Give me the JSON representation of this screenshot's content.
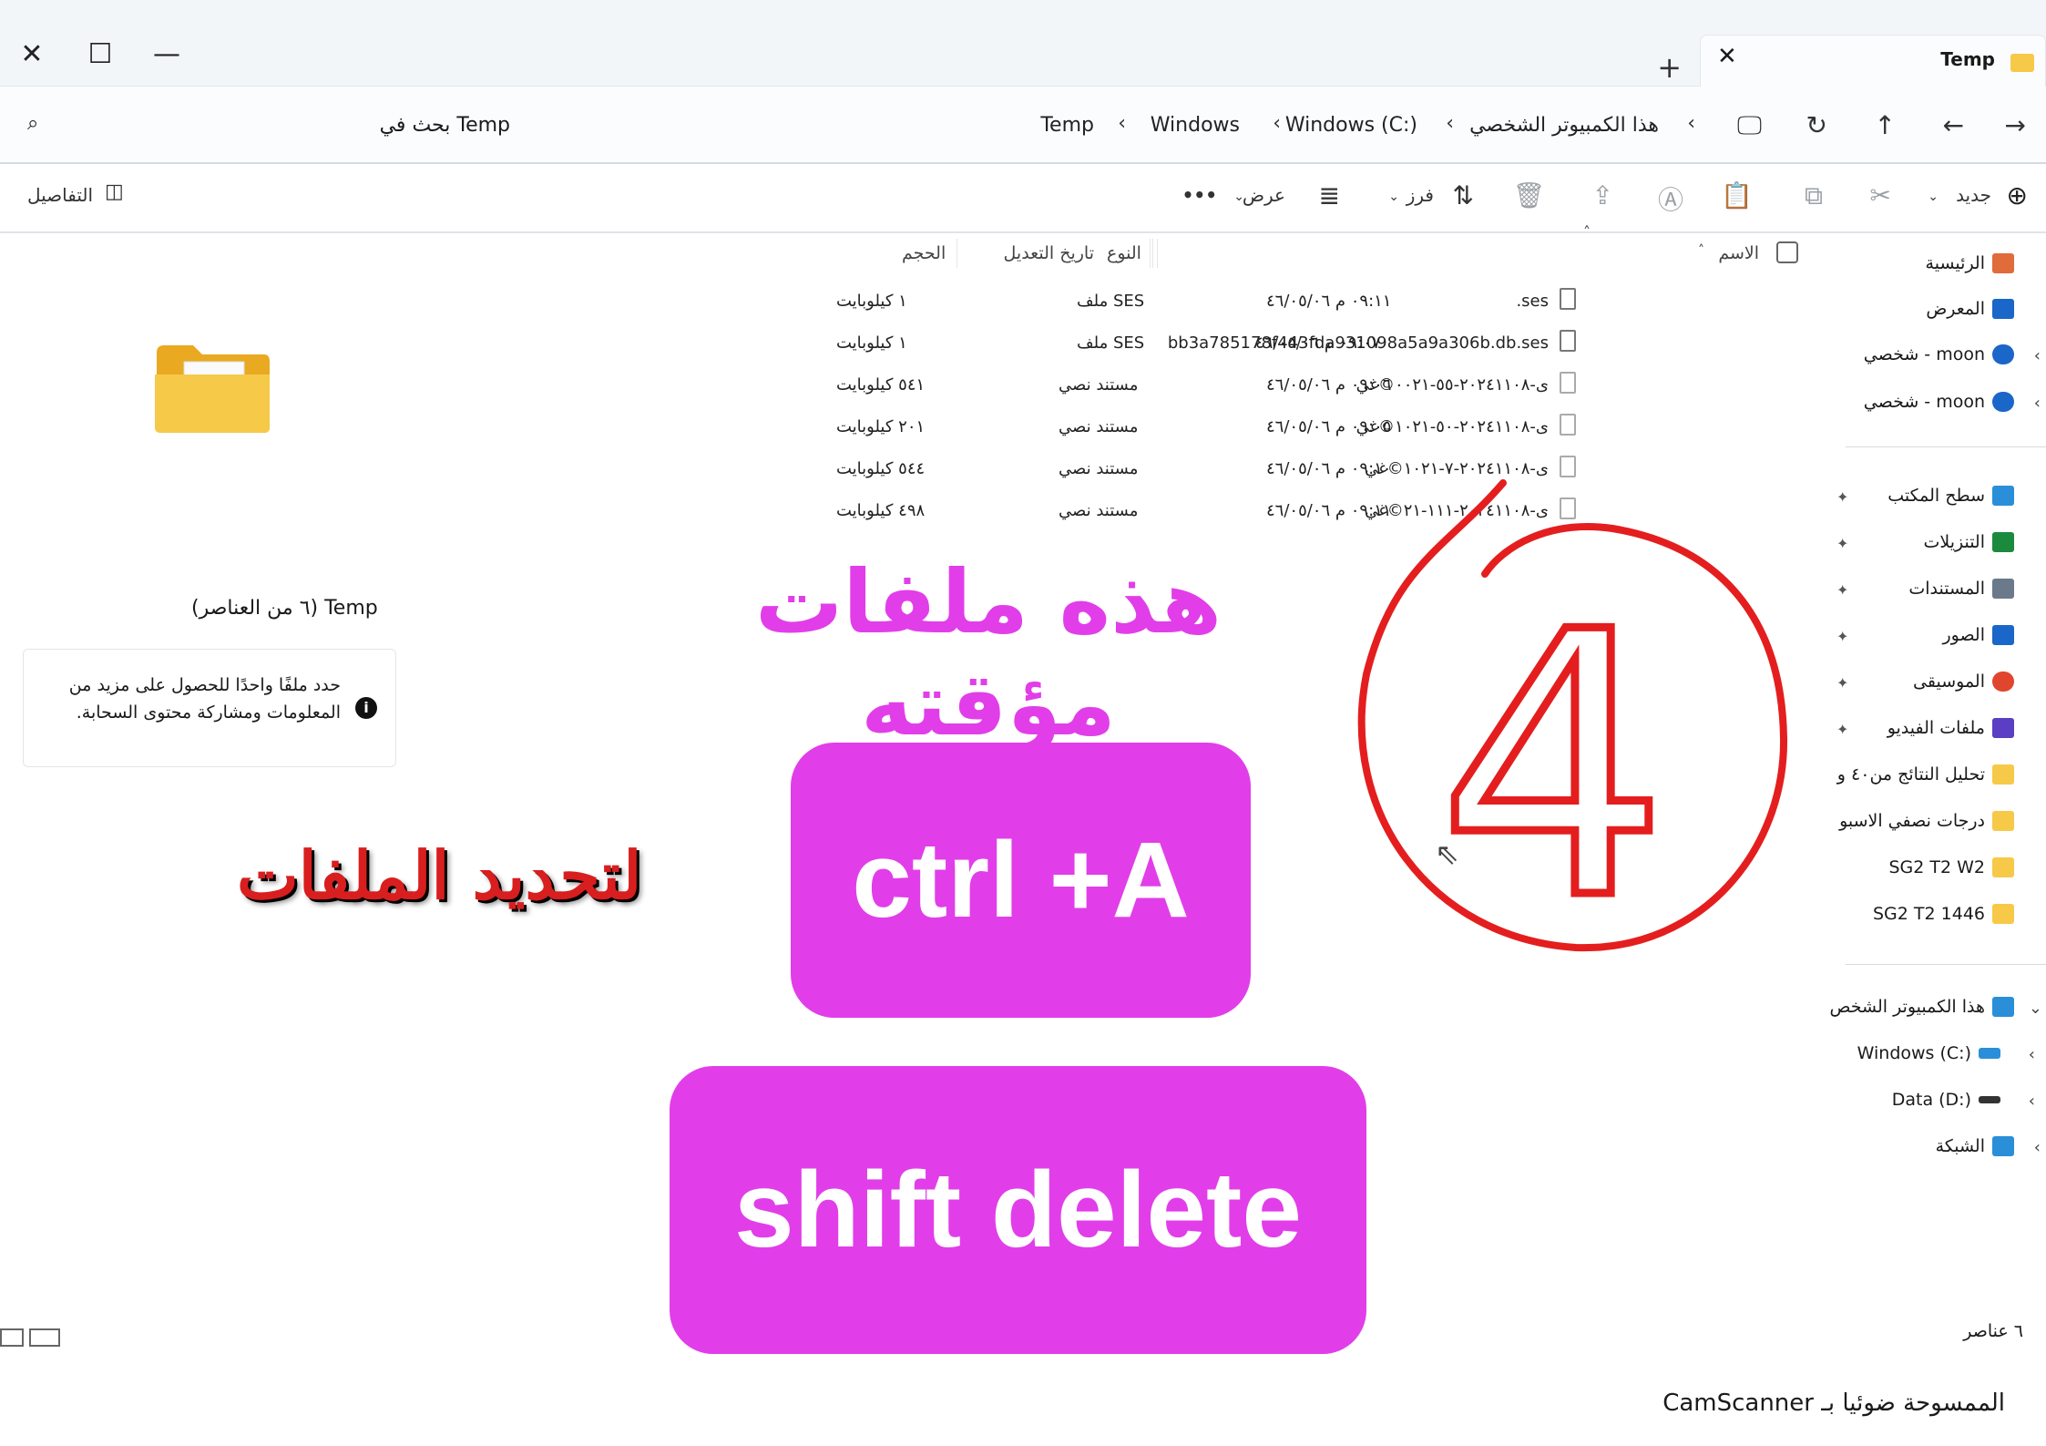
{
  "window": {
    "tab_title": "Temp",
    "close_tab": "✕",
    "new_tab": "+",
    "controls": {
      "close": "✕",
      "maximize": "☐",
      "minimize": "—"
    }
  },
  "address": {
    "breadcrumbs": [
      "هذا الكمبيوتر الشخصي",
      "Windows (C:)",
      "Windows",
      "Temp"
    ],
    "search_placeholder": "بحث في Temp"
  },
  "commandbar": {
    "new": "جديد",
    "sort": "فرز",
    "view": "عرض",
    "more": "•••",
    "details": "التفاصيل"
  },
  "sidebar": {
    "top": [
      {
        "label": "الرئيسية",
        "color": "#e06c3c"
      },
      {
        "label": "المعرض",
        "color": "#1a66c9"
      },
      {
        "label": "moon - شخصي",
        "color": "#1a66c9"
      },
      {
        "label": "moon - شخصي",
        "color": "#1a66c9"
      }
    ],
    "pinned": [
      {
        "label": "سطح المكتب",
        "color": "#2a8fd8"
      },
      {
        "label": "التنزيلات",
        "color": "#1b8a3c"
      },
      {
        "label": "المستندات",
        "color": "#6b7a8a"
      },
      {
        "label": "الصور",
        "color": "#1a66c9"
      },
      {
        "label": "الموسيقى",
        "color": "#e0462e"
      },
      {
        "label": "ملفات الفيديو",
        "color": "#5a3fc4"
      },
      {
        "label": "تحليل النتائج من٤٠ و",
        "color": "#f7c948"
      },
      {
        "label": "درجات نصفي الاسبو",
        "color": "#f7c948"
      },
      {
        "label": "SG2 T2 W2",
        "color": "#f7c948"
      },
      {
        "label": "SG2 T2 1446",
        "color": "#f7c948"
      }
    ],
    "drives": [
      {
        "label": "هذا الكمبيوتر الشخص",
        "color": "#2a8fd8"
      },
      {
        "label": "Windows (C:)",
        "color": "#2a8fd8"
      },
      {
        "label": "Data (D:)",
        "color": "#333333"
      },
      {
        "label": "الشبكة",
        "color": "#2a8fd8"
      }
    ]
  },
  "filelist": {
    "headers": {
      "name": "الاسم",
      "modified": "تاريخ التعديل",
      "type": "النوع",
      "size": "الحجم"
    },
    "rows": [
      {
        "name": ".ses",
        "modified": "٠٩:١١ م ٤٦/٠٥/٠٦",
        "type": "ملف SES",
        "size": "١ كيلوبايت"
      },
      {
        "name": "bb3a785178f443fda931098a5a9a306b.db.ses",
        "modified": "٠٩:٠٧ م ٤٦/٠٥/٠٦",
        "type": "ملف SES",
        "size": "١ كيلوبايت"
      },
      {
        "name": "ى-٢٠٢٤١١٠٨-٥٥-٠٠٢١©غي",
        "modified": "٠٩:٠٦ م ٤٦/٠٥/٠٦",
        "type": "مستند نصي",
        "size": "٥٤١ كيلوبايت"
      },
      {
        "name": "ى-٢٠٢٤١١٠٨-٥٠-١٠٢١©غي",
        "modified": "٠٩:٠٥ م ٤٦/٠٥/٠٦",
        "type": "مستند نصي",
        "size": "٢٠١ كيلوبايت"
      },
      {
        "name": "ى-٢٠٢٤١١٠٨-٧-١٠٢١©غي",
        "modified": "٠٩:١٠ م ٤٦/٠٥/٠٦",
        "type": "مستند نصي",
        "size": "٥٤٤ كيلوبايت"
      },
      {
        "name": "ى-٢٠٢٤١١٠٨-١١١-٢١©غي",
        "modified": "٠٩:١١ م ٤٦/٠٥/٠٦",
        "type": "مستند نصي",
        "size": "٤٩٨ كيلوبايت"
      }
    ]
  },
  "details": {
    "count_title": "Temp (٦ من العناصر)",
    "info": "حدد ملفًا واحدًا للحصول على مزيد من المعلومات ومشاركة محتوى السحابة.",
    "info_icon": "i"
  },
  "overlay": {
    "headline": "هذه ملفات مؤقته",
    "select_label": "لتحديد الملفات",
    "ctrl_a": "ctrl +A",
    "shift_delete": "shift delete",
    "step_number": "4"
  },
  "status": {
    "count": "٦ عناصر"
  },
  "footer": {
    "scanner": "الممسوحة ضوئيا بـ CamScanner"
  }
}
